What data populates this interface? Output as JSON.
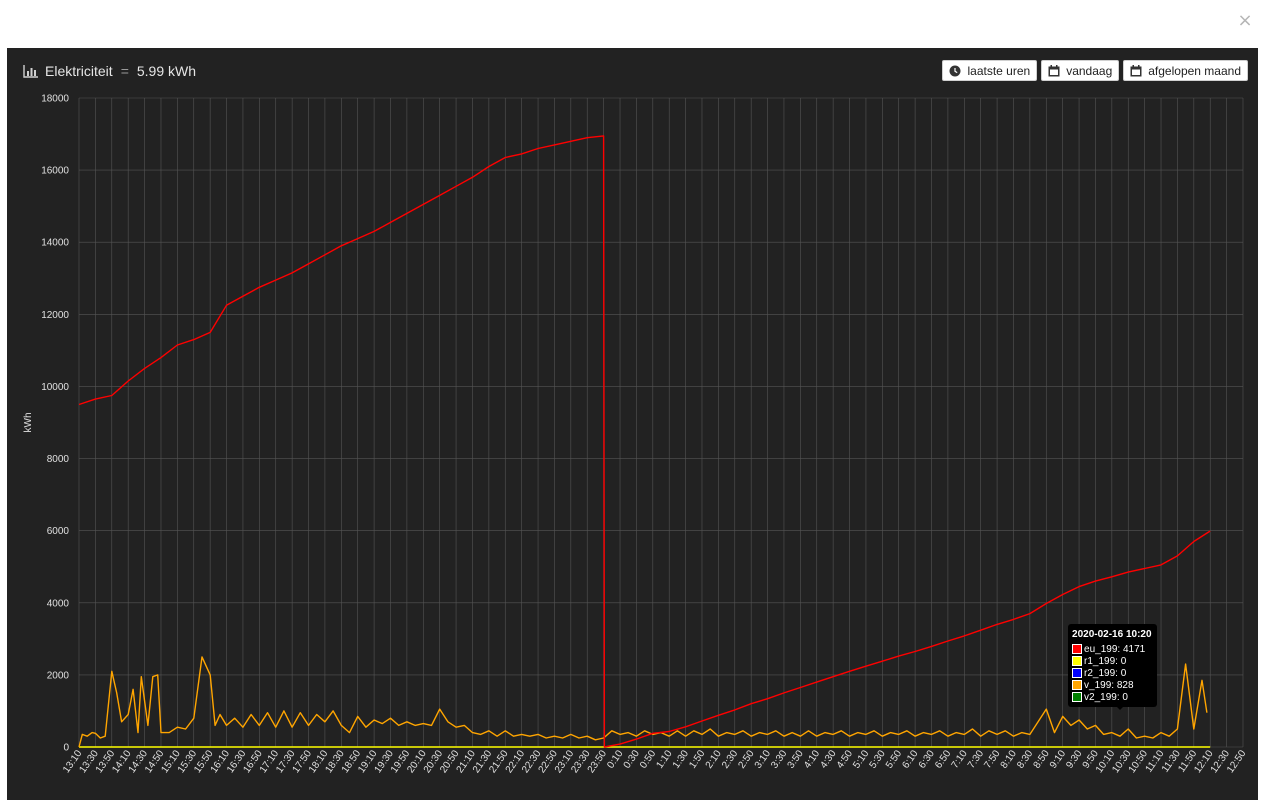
{
  "modal": {
    "close_label": "×"
  },
  "header": {
    "title": "Elektriciteit",
    "separator": "=",
    "total": "5.99 kWh",
    "buttons": [
      {
        "label": "laatste uren",
        "icon": "clock-icon"
      },
      {
        "label": "vandaag",
        "icon": "calendar-icon"
      },
      {
        "label": "afgelopen maand",
        "icon": "calendar-icon"
      }
    ]
  },
  "colors": {
    "eu_199": "#ff0000",
    "r1_199": "#ffff00",
    "r2_199": "#0000ff",
    "v_199": "#ffa500",
    "v2_199": "#008000",
    "grid": "#555555",
    "panel": "#222222"
  },
  "tooltip": {
    "title": "2020-02-16 10:20",
    "rows": [
      {
        "label": "eu_199: 4171",
        "color": "#ff0000"
      },
      {
        "label": "r1_199: 0",
        "color": "#ffff00"
      },
      {
        "label": "r2_199: 0",
        "color": "#0000ff"
      },
      {
        "label": "v_199: 828",
        "color": "#ffa500"
      },
      {
        "label": "v2_199: 0",
        "color": "#008000"
      }
    ]
  },
  "chart_data": {
    "type": "line",
    "ylabel": "kWh",
    "ylim": [
      0,
      18000
    ],
    "yticks": [
      0,
      2000,
      4000,
      6000,
      8000,
      10000,
      12000,
      14000,
      16000,
      18000
    ],
    "grid": true,
    "x_tick_labels": [
      "13:10",
      "13:30",
      "13:50",
      "14:10",
      "14:30",
      "14:50",
      "15:10",
      "15:30",
      "15:50",
      "16:10",
      "16:30",
      "16:50",
      "17:10",
      "17:30",
      "17:50",
      "18:10",
      "18:30",
      "18:50",
      "19:10",
      "19:30",
      "19:50",
      "20:10",
      "20:30",
      "20:50",
      "21:10",
      "21:30",
      "21:50",
      "22:10",
      "22:30",
      "22:50",
      "23:10",
      "23:30",
      "23:50",
      "0:10",
      "0:30",
      "0:50",
      "1:10",
      "1:30",
      "1:50",
      "2:10",
      "2:30",
      "2:50",
      "3:10",
      "3:30",
      "3:50",
      "4:10",
      "4:30",
      "4:50",
      "5:10",
      "5:30",
      "5:50",
      "6:10",
      "6:30",
      "6:50",
      "7:10",
      "7:30",
      "7:50",
      "8:10",
      "8:30",
      "8:50",
      "9:10",
      "9:30",
      "9:50",
      "10:10",
      "10:30",
      "10:50",
      "11:10",
      "11:30",
      "11:50",
      "12:10",
      "12:30",
      "12:50"
    ],
    "series": [
      {
        "name": "eu_199",
        "color": "#ff0000",
        "points": [
          [
            0,
            9500
          ],
          [
            1,
            9650
          ],
          [
            2,
            9750
          ],
          [
            3,
            10150
          ],
          [
            4,
            10500
          ],
          [
            5,
            10800
          ],
          [
            6,
            11150
          ],
          [
            7,
            11300
          ],
          [
            8,
            11500
          ],
          [
            9,
            12250
          ],
          [
            10,
            12500
          ],
          [
            11,
            12750
          ],
          [
            12,
            12950
          ],
          [
            13,
            13150
          ],
          [
            14,
            13400
          ],
          [
            15,
            13650
          ],
          [
            16,
            13900
          ],
          [
            17,
            14100
          ],
          [
            18,
            14300
          ],
          [
            19,
            14550
          ],
          [
            20,
            14800
          ],
          [
            21,
            15050
          ],
          [
            22,
            15300
          ],
          [
            23,
            15550
          ],
          [
            24,
            15800
          ],
          [
            25,
            16100
          ],
          [
            26,
            16350
          ],
          [
            27,
            16450
          ],
          [
            28,
            16600
          ],
          [
            29,
            16700
          ],
          [
            30,
            16800
          ],
          [
            31,
            16900
          ],
          [
            32,
            16950
          ],
          [
            32.05,
            0
          ],
          [
            33,
            80
          ],
          [
            34,
            220
          ],
          [
            35,
            380
          ],
          [
            36,
            430
          ],
          [
            37,
            560
          ],
          [
            38,
            720
          ],
          [
            39,
            880
          ],
          [
            40,
            1030
          ],
          [
            41,
            1200
          ],
          [
            42,
            1340
          ],
          [
            43,
            1500
          ],
          [
            44,
            1650
          ],
          [
            45,
            1800
          ],
          [
            46,
            1950
          ],
          [
            47,
            2100
          ],
          [
            48,
            2240
          ],
          [
            49,
            2380
          ],
          [
            50,
            2520
          ],
          [
            51,
            2650
          ],
          [
            52,
            2790
          ],
          [
            53,
            2940
          ],
          [
            54,
            3080
          ],
          [
            55,
            3240
          ],
          [
            56,
            3400
          ],
          [
            57,
            3540
          ],
          [
            58,
            3700
          ],
          [
            59,
            3980
          ],
          [
            60,
            4230
          ],
          [
            61,
            4450
          ],
          [
            62,
            4600
          ],
          [
            63,
            4720
          ],
          [
            64,
            4850
          ],
          [
            65,
            4950
          ],
          [
            66,
            5050
          ],
          [
            67,
            5300
          ],
          [
            68,
            5700
          ],
          [
            69,
            5990
          ]
        ]
      },
      {
        "name": "v_199",
        "color": "#ffa500",
        "points": [
          [
            0,
            0
          ],
          [
            0.2,
            350
          ],
          [
            0.5,
            300
          ],
          [
            0.8,
            400
          ],
          [
            1,
            380
          ],
          [
            1.3,
            250
          ],
          [
            1.6,
            300
          ],
          [
            2,
            2100
          ],
          [
            2.3,
            1500
          ],
          [
            2.6,
            700
          ],
          [
            3,
            900
          ],
          [
            3.3,
            1600
          ],
          [
            3.6,
            400
          ],
          [
            3.8,
            1950
          ],
          [
            4.2,
            600
          ],
          [
            4.5,
            1950
          ],
          [
            4.8,
            2000
          ],
          [
            5,
            400
          ],
          [
            5.5,
            400
          ],
          [
            6,
            550
          ],
          [
            6.5,
            500
          ],
          [
            7,
            800
          ],
          [
            7.5,
            2500
          ],
          [
            8,
            2000
          ],
          [
            8.3,
            600
          ],
          [
            8.6,
            900
          ],
          [
            9,
            600
          ],
          [
            9.5,
            800
          ],
          [
            10,
            550
          ],
          [
            10.5,
            900
          ],
          [
            11,
            600
          ],
          [
            11.5,
            950
          ],
          [
            12,
            550
          ],
          [
            12.5,
            1000
          ],
          [
            13,
            550
          ],
          [
            13.5,
            950
          ],
          [
            14,
            600
          ],
          [
            14.5,
            900
          ],
          [
            15,
            700
          ],
          [
            15.5,
            1000
          ],
          [
            16,
            600
          ],
          [
            16.5,
            400
          ],
          [
            17,
            850
          ],
          [
            17.5,
            550
          ],
          [
            18,
            750
          ],
          [
            18.5,
            650
          ],
          [
            19,
            800
          ],
          [
            19.5,
            600
          ],
          [
            20,
            700
          ],
          [
            20.5,
            600
          ],
          [
            21,
            650
          ],
          [
            21.5,
            600
          ],
          [
            22,
            1050
          ],
          [
            22.5,
            700
          ],
          [
            23,
            550
          ],
          [
            23.5,
            600
          ],
          [
            24,
            400
          ],
          [
            24.5,
            350
          ],
          [
            25,
            450
          ],
          [
            25.5,
            300
          ],
          [
            26,
            450
          ],
          [
            26.5,
            300
          ],
          [
            27,
            350
          ],
          [
            27.5,
            300
          ],
          [
            28,
            350
          ],
          [
            28.5,
            250
          ],
          [
            29,
            300
          ],
          [
            29.5,
            250
          ],
          [
            30,
            350
          ],
          [
            30.5,
            250
          ],
          [
            31,
            300
          ],
          [
            31.5,
            200
          ],
          [
            32,
            250
          ],
          [
            32.5,
            450
          ],
          [
            33,
            350
          ],
          [
            33.5,
            400
          ],
          [
            34,
            300
          ],
          [
            34.5,
            450
          ],
          [
            35,
            350
          ],
          [
            35.5,
            400
          ],
          [
            36,
            300
          ],
          [
            36.5,
            450
          ],
          [
            37,
            300
          ],
          [
            37.5,
            450
          ],
          [
            38,
            350
          ],
          [
            38.5,
            500
          ],
          [
            39,
            300
          ],
          [
            39.5,
            400
          ],
          [
            40,
            350
          ],
          [
            40.5,
            450
          ],
          [
            41,
            300
          ],
          [
            41.5,
            400
          ],
          [
            42,
            350
          ],
          [
            42.5,
            450
          ],
          [
            43,
            300
          ],
          [
            43.5,
            400
          ],
          [
            44,
            300
          ],
          [
            44.5,
            450
          ],
          [
            45,
            300
          ],
          [
            45.5,
            400
          ],
          [
            46,
            350
          ],
          [
            46.5,
            450
          ],
          [
            47,
            300
          ],
          [
            47.5,
            400
          ],
          [
            48,
            350
          ],
          [
            48.5,
            450
          ],
          [
            49,
            300
          ],
          [
            49.5,
            400
          ],
          [
            50,
            350
          ],
          [
            50.5,
            450
          ],
          [
            51,
            300
          ],
          [
            51.5,
            400
          ],
          [
            52,
            350
          ],
          [
            52.5,
            450
          ],
          [
            53,
            300
          ],
          [
            53.5,
            400
          ],
          [
            54,
            350
          ],
          [
            54.5,
            500
          ],
          [
            55,
            300
          ],
          [
            55.5,
            450
          ],
          [
            56,
            350
          ],
          [
            56.5,
            450
          ],
          [
            57,
            300
          ],
          [
            57.5,
            400
          ],
          [
            58,
            350
          ],
          [
            58.5,
            700
          ],
          [
            59,
            1050
          ],
          [
            59.5,
            400
          ],
          [
            60,
            850
          ],
          [
            60.5,
            600
          ],
          [
            61,
            750
          ],
          [
            61.5,
            500
          ],
          [
            62,
            600
          ],
          [
            62.5,
            350
          ],
          [
            63,
            400
          ],
          [
            63.5,
            300
          ],
          [
            64,
            500
          ],
          [
            64.5,
            250
          ],
          [
            65,
            300
          ],
          [
            65.5,
            250
          ],
          [
            66,
            400
          ],
          [
            66.5,
            300
          ],
          [
            67,
            500
          ],
          [
            67.5,
            2300
          ],
          [
            68,
            500
          ],
          [
            68.5,
            1850
          ],
          [
            68.8,
            950
          ]
        ]
      },
      {
        "name": "r1_199",
        "color": "#ffff00",
        "points": [
          [
            0,
            0
          ],
          [
            69,
            0
          ]
        ]
      }
    ]
  }
}
